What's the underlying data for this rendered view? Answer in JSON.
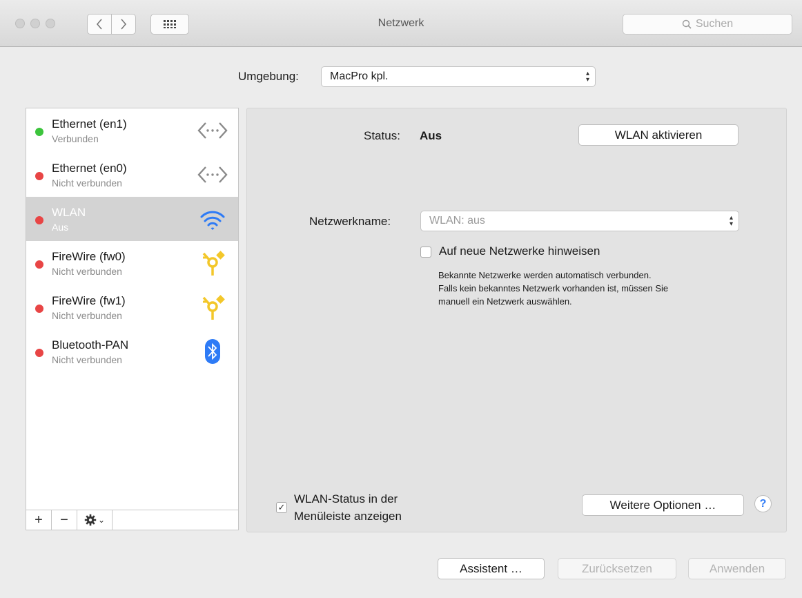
{
  "window": {
    "title": "Netzwerk"
  },
  "search": {
    "placeholder": "Suchen"
  },
  "environment": {
    "label": "Umgebung:",
    "value": "MacPro kpl."
  },
  "services": [
    {
      "name": "Ethernet (en1)",
      "status": "Verbunden",
      "dot_color": "#3cc43c",
      "icon": "ethernet-icon"
    },
    {
      "name": "Ethernet (en0)",
      "status": "Nicht verbunden",
      "dot_color": "#e84545",
      "icon": "ethernet-icon"
    },
    {
      "name": "WLAN",
      "status": "Aus",
      "dot_color": "#e84545",
      "icon": "wifi-icon",
      "selected": true
    },
    {
      "name": "FireWire (fw0)",
      "status": "Nicht verbunden",
      "dot_color": "#e84545",
      "icon": "firewire-icon"
    },
    {
      "name": "FireWire (fw1)",
      "status": "Nicht verbunden",
      "dot_color": "#e84545",
      "icon": "firewire-icon"
    },
    {
      "name": "Bluetooth-PAN",
      "status": "Nicht verbunden",
      "dot_color": "#e84545",
      "icon": "bluetooth-icon"
    }
  ],
  "sidebar_tools": {
    "add": "+",
    "remove": "−",
    "gear_caret": "⌄"
  },
  "detail": {
    "status_label": "Status:",
    "status_value": "Aus",
    "activate_button": "WLAN aktivieren",
    "network_name_label": "Netzwerkname:",
    "network_name_value": "WLAN: aus",
    "ask_join_label": "Auf neue Netzwerke hinweisen",
    "ask_join_checked": false,
    "info_line1": "Bekannte Netzwerke werden automatisch verbunden.",
    "info_line2": "Falls kein bekanntes Netzwerk vorhanden ist, müssen Sie",
    "info_line3": "manuell ein Netzwerk auswählen.",
    "menubar_status_line1": "WLAN-Status in der",
    "menubar_status_line2": "Menüleiste anzeigen",
    "menubar_status_checked": true,
    "advanced_button": "Weitere Optionen …",
    "help": "?"
  },
  "footer": {
    "assistant": "Assistent …",
    "revert": "Zurücksetzen",
    "apply": "Anwenden"
  },
  "colors": {
    "selection": "#d3d3d3",
    "wifi": "#2e7bf6",
    "bluetooth": "#2e7bf6",
    "firewire": "#f3c72a"
  }
}
